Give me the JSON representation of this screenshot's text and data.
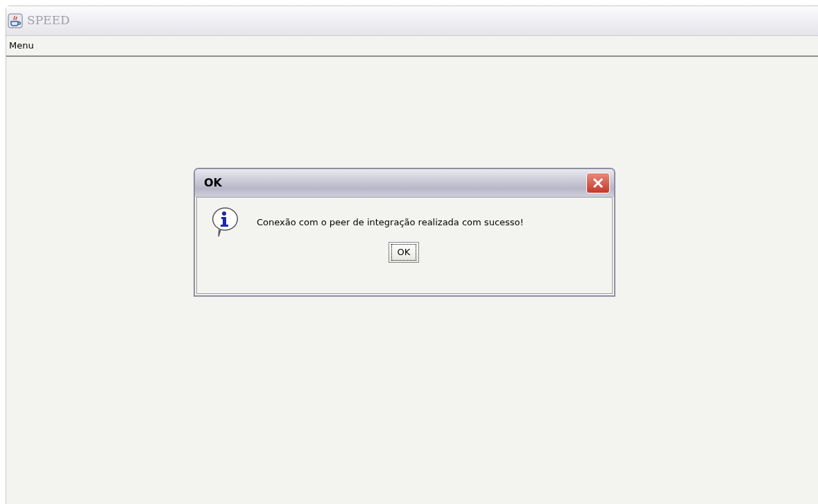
{
  "window": {
    "title": "SPEED"
  },
  "menu_bar": {
    "items": [
      "Menu"
    ]
  },
  "dialog": {
    "title": "OK",
    "message": "Conexão com o peer de integração realizada com sucesso!",
    "button": {
      "label": "OK",
      "focused": true
    }
  }
}
